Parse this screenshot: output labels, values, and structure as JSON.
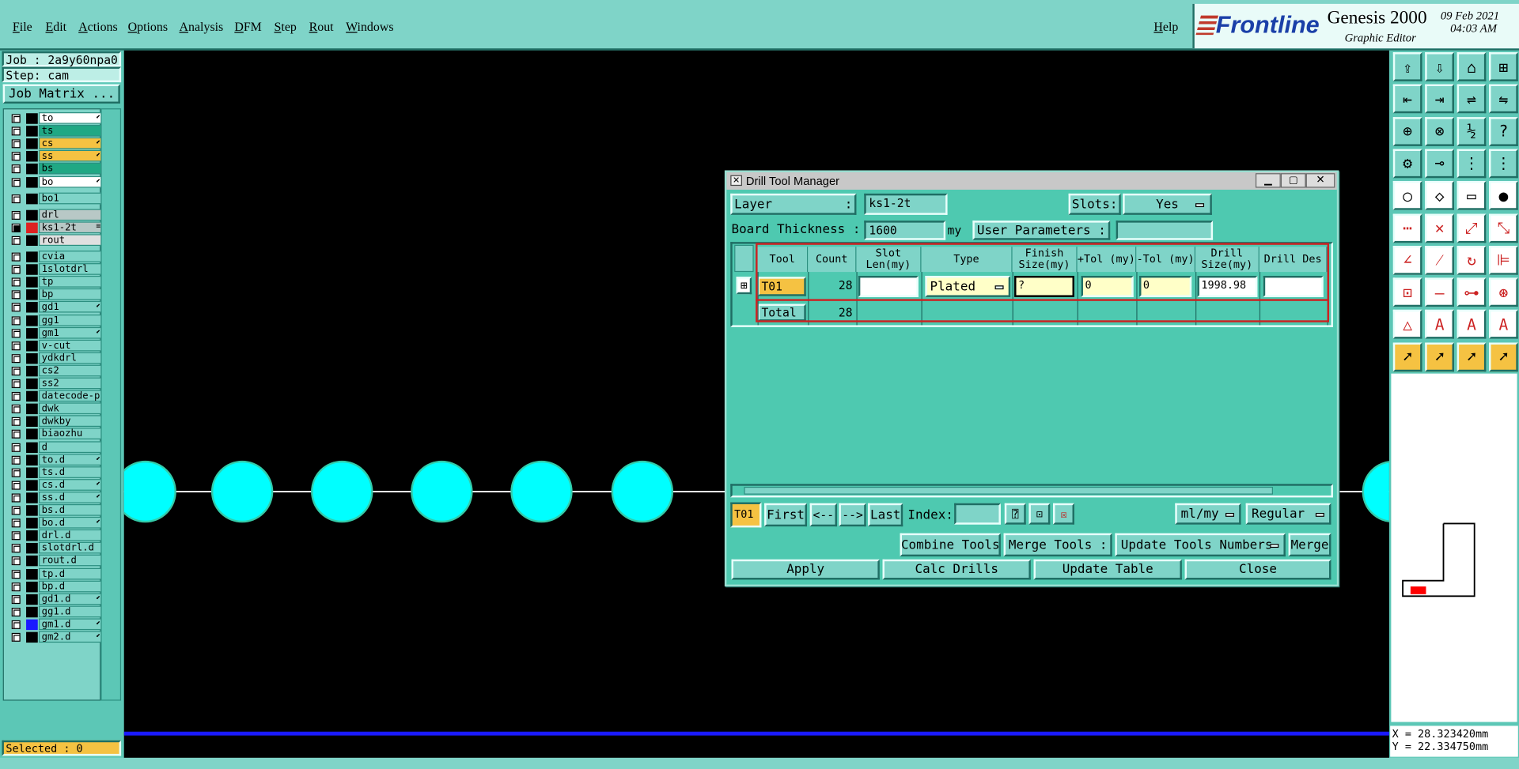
{
  "menu": {
    "items": [
      "File",
      "Edit",
      "Actions",
      "Options",
      "Analysis",
      "DFM",
      "Step",
      "Rout",
      "Windows"
    ],
    "help": "Help"
  },
  "brand": {
    "logo": "Frontline",
    "product": "Genesis 2000",
    "subtitle": "Graphic Editor",
    "date": "09 Feb 2021",
    "time": "04:03 AM"
  },
  "left": {
    "job": "Job : 2a9y60npa0",
    "step": "Step: cam",
    "job_matrix": "Job Matrix ...",
    "selected": "Selected : 0"
  },
  "layers": [
    {
      "name": "to",
      "color": "#ffffff",
      "mark": "⬋"
    },
    {
      "name": "ts",
      "color": "#20a884",
      "mark": ""
    },
    {
      "name": "cs",
      "color": "#f5c242",
      "mark": "⬋"
    },
    {
      "name": "ss",
      "color": "#f5c242",
      "mark": "⬋"
    },
    {
      "name": "bs",
      "color": "#20a884",
      "mark": ""
    },
    {
      "name": "bo",
      "color": "#ffffff",
      "mark": "⬋"
    },
    {
      "name": "bo1",
      "color": "#7fd4c8",
      "mark": ""
    },
    {
      "name": "drl",
      "color": "#b8c8c6",
      "mark": ""
    },
    {
      "name": "ks1-2t",
      "color": "#b8c8c6",
      "mark": "≡",
      "active": true
    },
    {
      "name": "rout",
      "color": "#e0e0e0",
      "mark": ""
    },
    {
      "name": "cvia",
      "color": "#7fd4c8",
      "mark": ""
    },
    {
      "name": "1slotdrl",
      "color": "#7fd4c8",
      "mark": ""
    },
    {
      "name": "tp",
      "color": "#7fd4c8",
      "mark": ""
    },
    {
      "name": "bp",
      "color": "#7fd4c8",
      "mark": ""
    },
    {
      "name": "gd1",
      "color": "#7fd4c8",
      "mark": "⬋"
    },
    {
      "name": "gg1",
      "color": "#7fd4c8",
      "mark": ""
    },
    {
      "name": "gm1",
      "color": "#7fd4c8",
      "mark": "⬋"
    },
    {
      "name": "v-cut",
      "color": "#7fd4c8",
      "mark": ""
    },
    {
      "name": "ydkdrl",
      "color": "#7fd4c8",
      "mark": ""
    },
    {
      "name": "cs2",
      "color": "#7fd4c8",
      "mark": ""
    },
    {
      "name": "ss2",
      "color": "#7fd4c8",
      "mark": ""
    },
    {
      "name": "datecode-pbe",
      "color": "#7fd4c8",
      "mark": ""
    },
    {
      "name": "dwk",
      "color": "#7fd4c8",
      "mark": ""
    },
    {
      "name": "dwkby",
      "color": "#7fd4c8",
      "mark": ""
    },
    {
      "name": "biaozhu",
      "color": "#7fd4c8",
      "mark": ""
    },
    {
      "name": "d",
      "color": "#7fd4c8",
      "mark": ""
    },
    {
      "name": "to.d",
      "color": "#7fd4c8",
      "mark": "⬋"
    },
    {
      "name": "ts.d",
      "color": "#7fd4c8",
      "mark": ""
    },
    {
      "name": "cs.d",
      "color": "#7fd4c8",
      "mark": "⬋"
    },
    {
      "name": "ss.d",
      "color": "#7fd4c8",
      "mark": "⬋"
    },
    {
      "name": "bs.d",
      "color": "#7fd4c8",
      "mark": ""
    },
    {
      "name": "bo.d",
      "color": "#7fd4c8",
      "mark": "⬋"
    },
    {
      "name": "drl.d",
      "color": "#7fd4c8",
      "mark": ""
    },
    {
      "name": "slotdrl.d",
      "color": "#7fd4c8",
      "mark": ""
    },
    {
      "name": "rout.d",
      "color": "#7fd4c8",
      "mark": ""
    },
    {
      "name": "tp.d",
      "color": "#7fd4c8",
      "mark": ""
    },
    {
      "name": "bp.d",
      "color": "#7fd4c8",
      "mark": ""
    },
    {
      "name": "gd1.d",
      "color": "#7fd4c8",
      "mark": "⬋"
    },
    {
      "name": "gg1.d",
      "color": "#7fd4c8",
      "mark": ""
    },
    {
      "name": "gm1.d",
      "color": "#7fd4c8",
      "mark": "⬋",
      "blue": true
    },
    {
      "name": "gm2.d",
      "color": "#7fd4c8",
      "mark": "⬋"
    }
  ],
  "dialog": {
    "title": "Drill Tool Manager",
    "layer_label": "Layer",
    "colon": ":",
    "layer_value": "ks1-2t",
    "slots_label": "Slots:",
    "slots_value": "Yes",
    "thickness_label": "Board Thickness :",
    "thickness_value": "1600",
    "thickness_unit": "my",
    "user_params_label": "User Parameters :",
    "user_params_value": "",
    "columns": [
      "Tool",
      "Count",
      "Slot Len(my)",
      "Type",
      "Finish Size(my)",
      "+Tol (my)",
      "-Tol (my)",
      "Drill Size(my)",
      "Drill Des"
    ],
    "row": {
      "tool": "T01",
      "count": "28",
      "slot_len": "",
      "type": "Plated",
      "finish": "?",
      "ptol": "0",
      "mtol": "0",
      "drill": "1998.98",
      "des": ""
    },
    "total": {
      "label": "Total",
      "count": "28"
    },
    "nav": {
      "current": "T01",
      "first": "First",
      "prev": "<--",
      "next": "-->",
      "last": "Last",
      "index_label": "Index:",
      "index_value": "",
      "units": "ml/my",
      "mode": "Regular"
    },
    "combine": "Combine Tools",
    "merge_label": "Merge Tools :",
    "merge_value": "Update Tools Numbers",
    "merge": "Merge",
    "apply": "Apply",
    "calc": "Calc Drills",
    "update": "Update Table",
    "close": "Close"
  },
  "coords": {
    "x": "X = 28.323420mm",
    "y": "Y = 22.334750mm"
  },
  "colors": {
    "panel": "#7fd4c8",
    "pad": "#00ffff",
    "pad_ring": "#33ccaa",
    "accent": "#f5c242",
    "highlight": "#cc2222",
    "baseline": "#1a1aff"
  }
}
